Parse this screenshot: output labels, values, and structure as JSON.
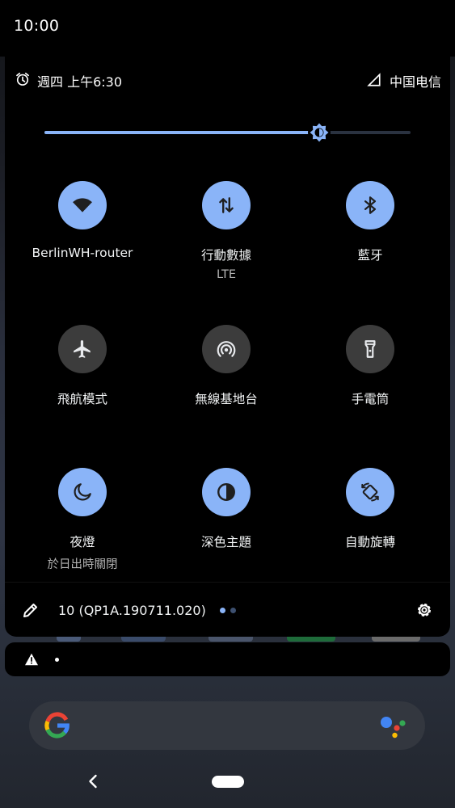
{
  "status_bar": {
    "time": "10:00"
  },
  "header": {
    "alarm_text": "週四 上午6:30",
    "carrier": "中国电信"
  },
  "brightness": {
    "level": 0.75
  },
  "tiles": [
    {
      "label": "BerlinWH-router",
      "sub": "",
      "icon": "wifi-icon",
      "active": true
    },
    {
      "label": "行動數據",
      "sub": "LTE",
      "icon": "mobile-data-icon",
      "active": true
    },
    {
      "label": "藍牙",
      "sub": "",
      "icon": "bluetooth-icon",
      "active": true
    },
    {
      "label": "飛航模式",
      "sub": "",
      "icon": "airplane-icon",
      "active": false
    },
    {
      "label": "無線基地台",
      "sub": "",
      "icon": "hotspot-icon",
      "active": false
    },
    {
      "label": "手電筒",
      "sub": "",
      "icon": "flashlight-icon",
      "active": false
    },
    {
      "label": "夜燈",
      "sub": "於日出時關閉",
      "icon": "moon-icon",
      "active": true
    },
    {
      "label": "深色主題",
      "sub": "",
      "icon": "dark-theme-icon",
      "active": true
    },
    {
      "label": "自動旋轉",
      "sub": "",
      "icon": "auto-rotate-icon",
      "active": true
    }
  ],
  "footer": {
    "build": "10 (QP1A.190711.020)",
    "page_count": 2,
    "current_page": 1
  },
  "colors": {
    "accent": "#8ab4f8",
    "tile_off": "#3c3c3c",
    "panel": "#000000"
  }
}
